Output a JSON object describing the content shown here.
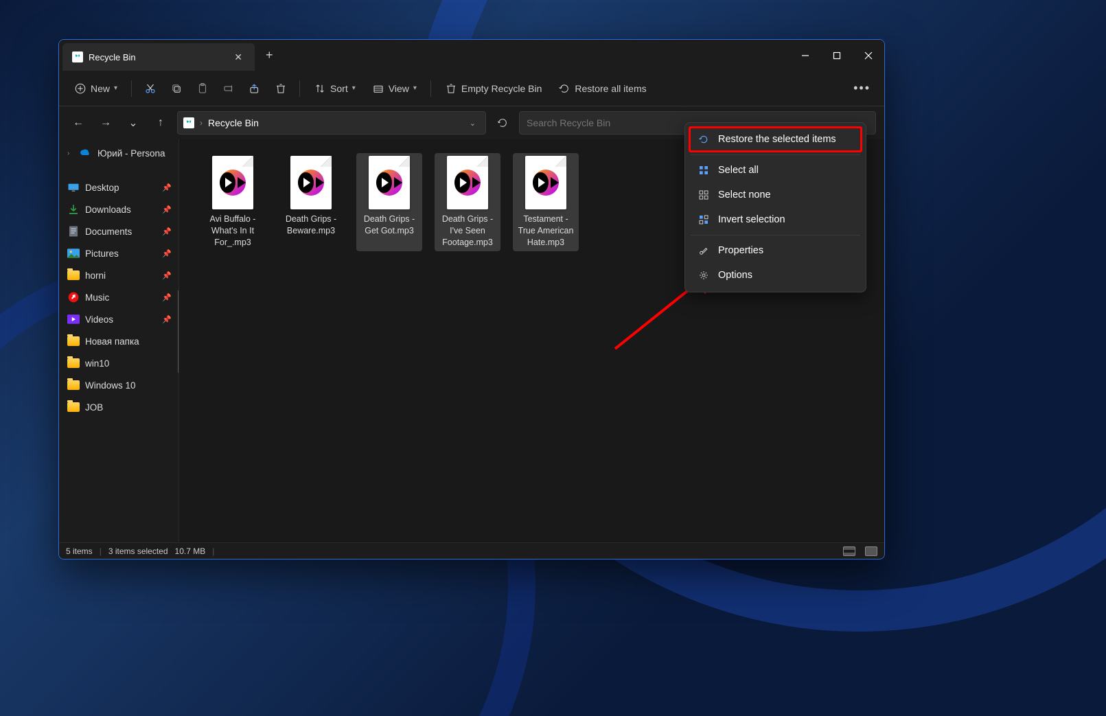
{
  "tab": {
    "title": "Recycle Bin"
  },
  "toolbar": {
    "new": "New",
    "sort": "Sort",
    "view": "View",
    "empty": "Empty Recycle Bin",
    "restore_all": "Restore all items"
  },
  "address": {
    "location": "Recycle Bin"
  },
  "search": {
    "placeholder": "Search Recycle Bin"
  },
  "sidebar": {
    "cloud": "Юрий - Persona",
    "quick": [
      "Desktop",
      "Downloads",
      "Documents",
      "Pictures",
      "horni",
      "Music",
      "Videos"
    ],
    "folders": [
      "Новая папка",
      "win10",
      "Windows 10",
      "JOB"
    ]
  },
  "files": [
    {
      "name": "Avi Buffalo - What's In It For_.mp3",
      "selected": false
    },
    {
      "name": "Death Grips - Beware.mp3",
      "selected": false
    },
    {
      "name": "Death Grips - Get Got.mp3",
      "selected": true
    },
    {
      "name": "Death Grips - I've Seen Footage.mp3",
      "selected": true
    },
    {
      "name": "Testament - True American Hate.mp3",
      "selected": true
    }
  ],
  "popup": {
    "restore_selected": "Restore the selected items",
    "select_all": "Select all",
    "select_none": "Select none",
    "invert": "Invert selection",
    "properties": "Properties",
    "options": "Options"
  },
  "status": {
    "count": "5 items",
    "selected": "3 items selected",
    "size": "10.7 MB"
  }
}
